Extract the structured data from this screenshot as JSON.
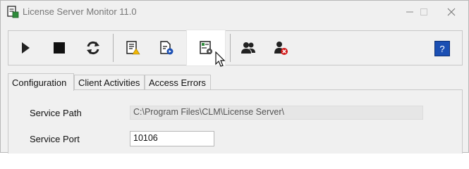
{
  "window": {
    "title": "License Server Monitor 11.0"
  },
  "toolbar": {
    "buttons": [
      {
        "icon": "play-icon"
      },
      {
        "icon": "stop-icon"
      },
      {
        "icon": "refresh-icon"
      },
      {
        "icon": "log-warning-icon"
      },
      {
        "icon": "log-info-icon"
      },
      {
        "icon": "settings-document-icon"
      },
      {
        "icon": "users-icon"
      },
      {
        "icon": "remove-user-icon"
      }
    ],
    "help_label": "?"
  },
  "tabs": [
    {
      "label": "Configuration",
      "active": true
    },
    {
      "label": "Client Activities",
      "active": false
    },
    {
      "label": "Access Errors",
      "active": false
    }
  ],
  "config": {
    "service_path_label": "Service Path",
    "service_path_value": "C:\\Program Files\\CLM\\License Server\\",
    "service_port_label": "Service Port",
    "service_port_value": "10106"
  },
  "colors": {
    "help_button": "#1b4fb3",
    "accent_green": "#2e8b3a",
    "error_red": "#d11b1b"
  }
}
